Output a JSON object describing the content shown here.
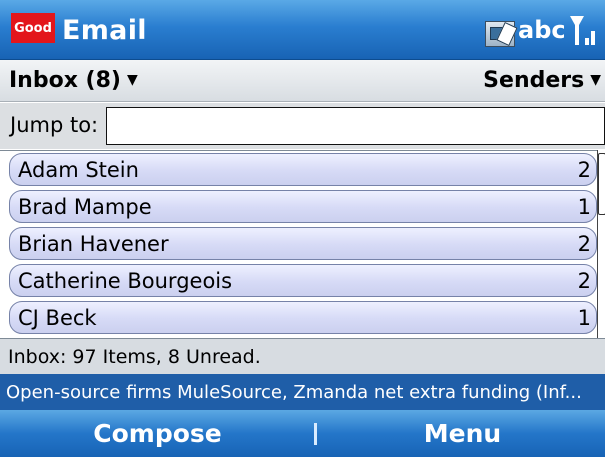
{
  "titlebar": {
    "logo_text": "Good",
    "title": "Email",
    "input_mode": "abc",
    "icons": [
      "sync-icon",
      "signal-icon"
    ]
  },
  "header": {
    "folder": "Inbox (8)",
    "sort": "Senders"
  },
  "jump": {
    "label": "Jump to:",
    "value": "",
    "placeholder": ""
  },
  "senders": [
    {
      "name": "Adam Stein",
      "count": "2"
    },
    {
      "name": "Brad Mampe",
      "count": "1"
    },
    {
      "name": "Brian Havener",
      "count": "2"
    },
    {
      "name": "Catherine Bourgeois",
      "count": "2"
    },
    {
      "name": "CJ Beck",
      "count": "1"
    }
  ],
  "status": {
    "text": "Inbox: 97 Items, 8 Unread."
  },
  "ticker": {
    "text": "Open-source firms MuleSource, Zmanda net extra funding (Inf..."
  },
  "softkeys": {
    "left": "Compose",
    "right": "Menu"
  },
  "colors": {
    "titlebar": "#2a7ed0",
    "brand_red": "#e3161b",
    "row_fill": "#d6daf6",
    "ticker": "#1f5ea8"
  }
}
